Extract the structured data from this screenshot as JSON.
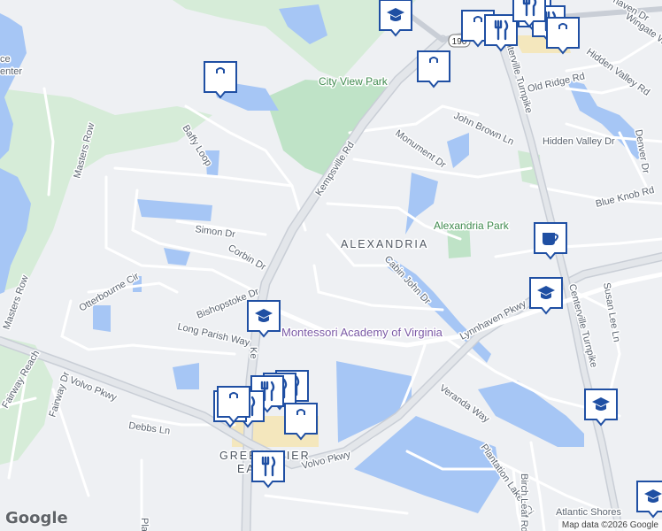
{
  "map": {
    "labels": {
      "city_view_park": "City View Park",
      "alexandria_park": "Alexandria Park",
      "alexandria": "ALEXANDRIA",
      "montessori": "Montessori Academy of Virginia",
      "greenbrier": "GREENBRIER",
      "east": "EAST",
      "atlantic_shores": "Atlantic Shores",
      "service_center_1": "ce",
      "service_center_2": "enter"
    },
    "roads": {
      "kempsville": "Kempsville Rd",
      "kempsville_short": "Ke",
      "centerville_top": "Centerville Turnpike",
      "centerville_right": "Centerville Turnpike",
      "lynnhaven": "Lynnhaven Pkwy",
      "volvo_left": "Volvo Pkwy",
      "volvo_bottom": "Volvo Pkwy",
      "veranda": "Veranda Way",
      "plantation": "Plantation Lakes Ci",
      "birch": "Birch Leaf Rd",
      "cabin_john": "Cabin John Dr",
      "monument": "Monument Dr",
      "john_brown": "John Brown Ln",
      "hidden_valley_dr": "Hidden Valley Dr",
      "hidden_valley_rd": "Hidden Valley Rd",
      "old_ridge": "Old Ridge Rd",
      "blue_knob": "Blue Knob Rd",
      "denver": "Denver Dr",
      "susan_lee": "Susan Lee Ln",
      "wingate": "Wingate Woods",
      "haven": "haven Dr",
      "simon": "Simon Dr",
      "corbin": "Corbin Dr",
      "bishopstoke": "Bishopstoke Dr",
      "long_parish": "Long Parish Way",
      "debbs": "Debbs Ln",
      "baffy": "Baffy Loop",
      "masters_rd": "Masters Row",
      "masters_left": "Masters Row",
      "otterbourne": "Otterbourne Cir",
      "fairway_reach": "Fairway Reach",
      "fairway_dr": "Fairway Dr",
      "placid": "Placi",
      "route_190": "190"
    },
    "pins": [
      {
        "icon": "school-icon"
      },
      {
        "icon": "shopping-bag-icon"
      },
      {
        "icon": "shopping-bag-icon"
      },
      {
        "icon": "shopping-bag-icon"
      },
      {
        "icon": "restaurant-icon"
      },
      {
        "icon": "restaurant-icon"
      },
      {
        "icon": "restaurant-icon"
      },
      {
        "icon": "shopping-bag-icon"
      },
      {
        "icon": "restaurant-icon"
      },
      {
        "icon": "cafe-icon"
      },
      {
        "icon": "school-icon"
      },
      {
        "icon": "school-icon"
      },
      {
        "icon": "school-icon"
      },
      {
        "icon": "restaurant-icon"
      },
      {
        "icon": "restaurant-icon"
      },
      {
        "icon": "restaurant-icon"
      },
      {
        "icon": "shopping-bag-icon"
      },
      {
        "icon": "restaurant-icon"
      },
      {
        "icon": "restaurant-icon"
      },
      {
        "icon": "shopping-bag-icon"
      },
      {
        "icon": "restaurant-icon"
      },
      {
        "icon": "school-icon"
      }
    ],
    "colors": {
      "water": "#a6c6f5",
      "park": "#cde9d6",
      "golf": "#d8ecd9",
      "pin": "#1f4fa3"
    }
  },
  "footer": {
    "logo": "Google",
    "attribution": "Map data ©2026 Google"
  }
}
